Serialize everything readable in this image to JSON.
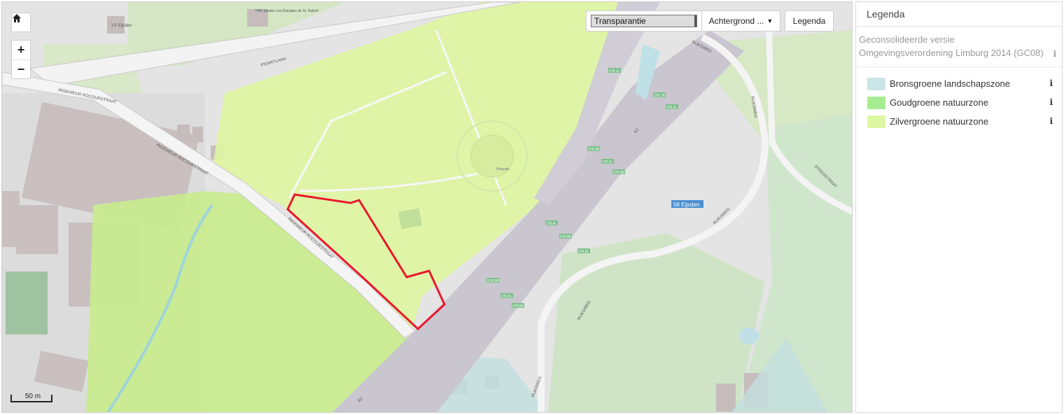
{
  "map": {
    "controls": {
      "home_icon": "home-icon",
      "zoom_in_label": "+",
      "zoom_out_label": "−"
    },
    "toolbar": {
      "transparency_label": "Transparantie",
      "background_label": "Achtergrond ...",
      "legend_button_label": "Legenda"
    },
    "scale_label": "50 m",
    "labels": {
      "road_pisartlaan": "PISARTLAAN",
      "road_ingenieur_1": "INGENIEUR ROCOURSTRAAT",
      "road_ingenieur_2": "INGENIEUR ROCOURSTRAAT",
      "road_ingenieur_3": "INGENIEUR ROCOURSTRAAT",
      "road_rijksweg_1": "RIJKSWEG",
      "road_rijksweg_2": "RIJKSWEG",
      "road_rijksweg_3": "RIJKSWEG",
      "road_rijksweg_4": "RIJKSWEG",
      "road_rijksweg_5": "RIJKSWEG",
      "road_steenstraat": "STEENSTRAAT",
      "road_a2_1": "A2",
      "road_a2_2": "A2",
      "building_school": "HBS Eijsden\nLes Disciples\nde St. Hubert",
      "building_vv": "VV Eijsden",
      "junction": "58 Eijsden",
      "chapel": "Wegwijs"
    },
    "km_markers": [
      "276,1L",
      "276,1R",
      "276,2L",
      "276,2R",
      "276,3L",
      "276,3R",
      "276,4L",
      "276,4R",
      "276,5L",
      "276,5R",
      "276,6L",
      "276,6R"
    ]
  },
  "legend": {
    "title": "Legenda",
    "subtitle": "Geconsolideerde versie Omgevingsverordening Limburg 2014 (GC08)",
    "info_symbol": "i",
    "items": [
      {
        "label": "Bronsgroene landschapszone",
        "color": "#cbe4e6"
      },
      {
        "label": "Goudgroene natuurzone",
        "color": "#a8ec92"
      },
      {
        "label": "Zilvergroene natuurzone",
        "color": "#ddf7a2"
      }
    ]
  },
  "colors": {
    "parcel_outline": "#e8182c",
    "zilvergroen_overlay": "#dff5a0",
    "goudgroen_overlay": "#c6ec8a",
    "bronsgroen_overlay": "#bfdde0",
    "road_fill": "#c9c6cf",
    "building_fill": "#c6bcbc",
    "background": "#e8e8e8"
  }
}
